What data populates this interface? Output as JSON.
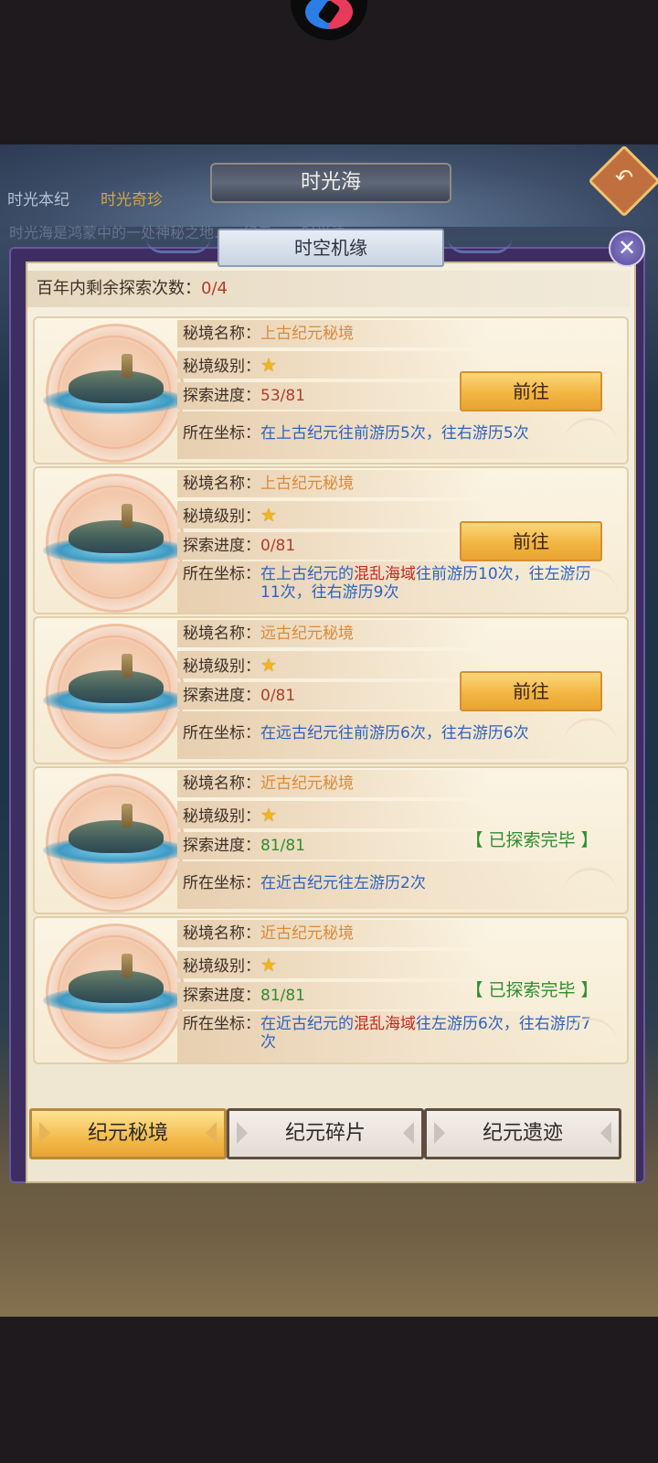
{
  "scene": {
    "title": "时光海",
    "tabs": [
      "时光本纪",
      "时光奇珍"
    ],
    "bg_text": "时光海是鸿蒙中的一处神秘之地……纪元……时光法……"
  },
  "dialog": {
    "title": "时空机缘",
    "remaining_label": "百年内剩余探索次数：",
    "remaining_value": "0/4",
    "close_icon": "close-icon"
  },
  "labels": {
    "name": "秘境名称：",
    "level": "秘境级别：",
    "progress": "探索进度：",
    "coords": "所在坐标："
  },
  "cards": [
    {
      "name": "上古纪元秘境",
      "stars": 1,
      "star": "★",
      "progress": "53/81",
      "coords": [
        {
          "t": "在上古纪元往前游历5次，往右游历5次",
          "c": "blue"
        }
      ],
      "action": "前往"
    },
    {
      "name": "上古纪元秘境",
      "stars": 1,
      "star": "★",
      "progress": "0/81",
      "coords_a": "在上古纪元的",
      "coords_b": "混乱海域",
      "coords_c": "往前游历10次，往左游历11次，往右游历9次",
      "action": "前往"
    },
    {
      "name": "远古纪元秘境",
      "stars": 1,
      "star": "★",
      "progress": "0/81",
      "coords": [
        {
          "t": "在远古纪元往前游历6次，往右游历6次",
          "c": "blue"
        }
      ],
      "action": "前往"
    },
    {
      "name": "近古纪元秘境",
      "stars": 1,
      "star": "★",
      "progress": "81/81",
      "coords": [
        {
          "t": "在近古纪元往左游历2次",
          "c": "blue"
        }
      ],
      "status": "【 已探索完毕 】"
    },
    {
      "name": "近古纪元秘境",
      "stars": 1,
      "star": "★",
      "progress": "81/81",
      "coords_a": "在近古纪元的",
      "coords_b": "混乱海域",
      "coords_c": "往左游历6次，往右游历7次",
      "status": "【 已探索完毕 】"
    }
  ],
  "bottom_tabs": [
    "纪元秘境",
    "纪元碎片",
    "纪元遗迹"
  ],
  "active_tab": 0
}
